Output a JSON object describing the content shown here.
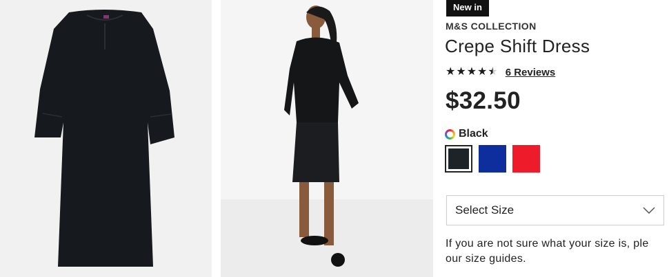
{
  "product": {
    "badge": "New in",
    "brand": "M&S COLLECTION",
    "title": "Crepe Shift Dress",
    "rating": {
      "value": 4.5,
      "max": 5,
      "icon": "star-icon"
    },
    "reviews_link": "6 Reviews",
    "price": "$32.50",
    "selected_colour": "Black",
    "colour_icon": "colour-ring-icon",
    "swatches": [
      {
        "name": "Black",
        "color": "#1e2328",
        "selected": true
      },
      {
        "name": "Blue",
        "color": "#0f2e9e",
        "selected": false
      },
      {
        "name": "Red",
        "color": "#ee1c2b",
        "selected": false
      }
    ],
    "size_select": {
      "label": "Select Size",
      "icon": "chevron-down-icon"
    },
    "size_help_line1": "If you are not sure what your size is, ple",
    "size_help_line2": "our size guides."
  },
  "images": [
    {
      "name": "dress-flat-lay-image",
      "background": "#f1f1f1"
    },
    {
      "name": "model-wearing-dress-image",
      "background": "#f5f5f5"
    }
  ],
  "colors": {
    "text": "#222222",
    "badge_bg": "#111111",
    "star": "#1b1b1b",
    "border": "#cfcfcf"
  }
}
